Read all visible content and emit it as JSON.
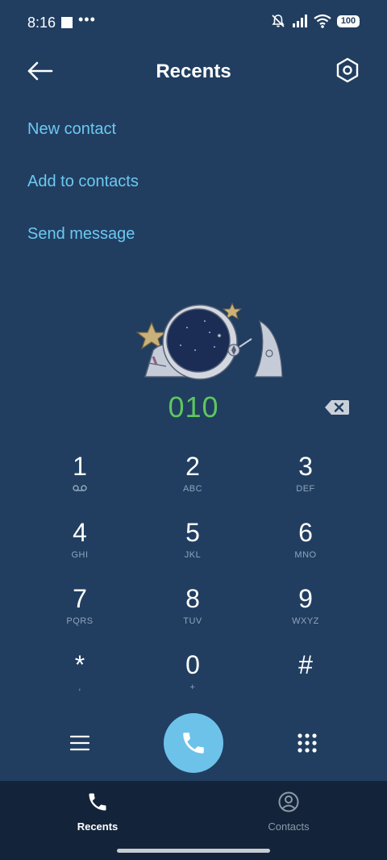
{
  "status_bar": {
    "time": "8:16",
    "dots": "•••",
    "battery": "100"
  },
  "header": {
    "title": "Recents"
  },
  "actions": {
    "new_contact": "New contact",
    "add_to_contacts": "Add to contacts",
    "send_message": "Send message"
  },
  "dialer": {
    "number": "010",
    "keys": [
      {
        "digit": "1",
        "sub": "voicemail-icon"
      },
      {
        "digit": "2",
        "sub": "ABC"
      },
      {
        "digit": "3",
        "sub": "DEF"
      },
      {
        "digit": "4",
        "sub": "GHI"
      },
      {
        "digit": "5",
        "sub": "JKL"
      },
      {
        "digit": "6",
        "sub": "MNO"
      },
      {
        "digit": "7",
        "sub": "PQRS"
      },
      {
        "digit": "8",
        "sub": "TUV"
      },
      {
        "digit": "9",
        "sub": "WXYZ"
      },
      {
        "digit": "*",
        "sub": ","
      },
      {
        "digit": "0",
        "sub": "+"
      },
      {
        "digit": "#",
        "sub": ""
      }
    ]
  },
  "bottom_nav": {
    "recents": "Recents",
    "contacts": "Contacts"
  },
  "colors": {
    "background": "#213e60",
    "link": "#6dc8f2",
    "number": "#5ec65e",
    "call_button": "#6dc2ea",
    "nav_background": "#13243a"
  },
  "icons": {
    "back": "arrow-left-icon",
    "settings": "hexagon-settings-icon",
    "backspace": "backspace-icon",
    "menu": "hamburger-icon",
    "call": "phone-icon",
    "keypad": "dialpad-icon",
    "recents_tab": "phone-icon",
    "contacts_tab": "person-circle-icon"
  }
}
